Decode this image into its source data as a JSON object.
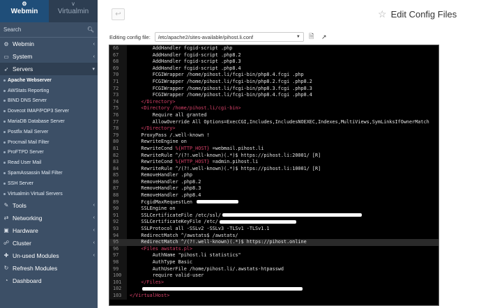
{
  "sidebar": {
    "tabs": [
      {
        "label": "Webmin",
        "icon": "webmin-logo-icon"
      },
      {
        "label": "Virtualmin",
        "icon": "virtualmin-chevron-icon"
      }
    ],
    "search_label": "Search",
    "items_top": [
      {
        "label": "Webmin",
        "icon": "gear-icon"
      },
      {
        "label": "System",
        "icon": "monitor-icon"
      },
      {
        "label": "Servers",
        "icon": "rocket-icon",
        "open": true
      }
    ],
    "server_modules": [
      "Apache Webserver",
      "AWStats Reporting",
      "BIND DNS Server",
      "Dovecot IMAP/POP3 Server",
      "MariaDB Database Server",
      "Postfix Mail Server",
      "Procmail Mail Filter",
      "ProFTPD Server",
      "Read User Mail",
      "SpamAssassin Mail Filter",
      "SSH Server",
      "Virtualmin Virtual Servers"
    ],
    "items_bottom": [
      {
        "label": "Tools",
        "icon": "wrench-icon",
        "chev": true
      },
      {
        "label": "Networking",
        "icon": "network-icon",
        "chev": true
      },
      {
        "label": "Hardware",
        "icon": "hardware-icon",
        "chev": true
      },
      {
        "label": "Cluster",
        "icon": "cluster-icon",
        "chev": true
      },
      {
        "label": "Un-used Modules",
        "icon": "puzzle-icon",
        "chev": true
      },
      {
        "label": "Refresh Modules",
        "icon": "refresh-icon",
        "chev": false
      },
      {
        "label": "Dashboard",
        "icon": "dashboard-icon",
        "chev": false
      }
    ]
  },
  "main": {
    "title": "Edit Config Files",
    "editing_label": "Editing config file:",
    "config_file": "/etc/apache2/sites-available/pihost.li.conf"
  },
  "editor": {
    "lines": [
      {
        "n": "66",
        "t": "        AddHandler fcgid-script .php"
      },
      {
        "n": "67",
        "t": "        AddHandler fcgid-script .php8.2"
      },
      {
        "n": "68",
        "t": "        AddHandler fcgid-script .php8.3"
      },
      {
        "n": "69",
        "t": "        AddHandler fcgid-script .php8.4"
      },
      {
        "n": "70",
        "t": "        FCGIWrapper /home/pihost.li/fcgi-bin/php8.4.fcgi .php"
      },
      {
        "n": "71",
        "t": "        FCGIWrapper /home/pihost.li/fcgi-bin/php8.2.fcgi .php8.2"
      },
      {
        "n": "72",
        "t": "        FCGIWrapper /home/pihost.li/fcgi-bin/php8.3.fcgi .php8.3"
      },
      {
        "n": "73",
        "t": "        FCGIWrapper /home/pihost.li/fcgi-bin/php8.4.fcgi .php8.4"
      },
      {
        "n": "74",
        "t": "    </Directory>",
        "tag": true
      },
      {
        "n": "75",
        "t": "    <Directory /home/pihost.li/cgi-bin>",
        "tag": true
      },
      {
        "n": "76",
        "t": "        Require all granted"
      },
      {
        "n": "77",
        "t": "        AllowOverride All Options=ExecCGI,Includes,IncludesNOEXEC,Indexes,MultiViews,SymLinksIfOwnerMatch"
      },
      {
        "n": "78",
        "t": "    </Directory>",
        "tag": true
      },
      {
        "n": "79",
        "t": "    ProxyPass /.well-known !"
      },
      {
        "n": "80",
        "t": "    RewriteEngine on"
      },
      {
        "n": "81",
        "a": "    RewriteCond ",
        "r": "%{HTTP_HOST}",
        "b": " =webmail.pihost.li"
      },
      {
        "n": "82",
        "t": "    RewriteRule ^/(?!.well-known)(.*)$ https://pihost.li:20001/ [R]"
      },
      {
        "n": "83",
        "a": "    RewriteCond ",
        "r": "%{HTTP_HOST}",
        "b": " =admin.pihost.li"
      },
      {
        "n": "84",
        "t": "    RewriteRule ^/(?!.well-known)(.*)$ https://pihost.li:10001/ [R]"
      },
      {
        "n": "85",
        "t": "    RemoveHandler .php"
      },
      {
        "n": "86",
        "t": "    RemoveHandler .php8.2"
      },
      {
        "n": "87",
        "t": "    RemoveHandler .php8.3"
      },
      {
        "n": "88",
        "t": "    RemoveHandler .php8.4"
      },
      {
        "n": "89",
        "t": "    FcgidMaxRequestLen ",
        "redact": 60
      },
      {
        "n": "90",
        "t": "    SSLEngine on"
      },
      {
        "n": "91",
        "t": "    SSLCertificateFile /etc/ssl/",
        "redact": 200
      },
      {
        "n": "92",
        "t": "    SSLCertificateKeyFile /etc/",
        "redact": 110
      },
      {
        "n": "93",
        "t": "    SSLProtocol all -SSLv2 -SSLv3 -TLSv1 -TLSv1.1"
      },
      {
        "n": "94",
        "t": "    RedirectMatch ^/awstats$ /awstats/"
      },
      {
        "n": "95",
        "t": "    RedirectMatch ^/(?!.well-known)(.*)$ https://pihost.online",
        "hl": true,
        "arrow": true
      },
      {
        "n": "96",
        "t": "    <Files awstats.pl>",
        "tag": true
      },
      {
        "n": "97",
        "t": "        AuthName \"pihost.li statistics\""
      },
      {
        "n": "98",
        "t": "        AuthType Basic"
      },
      {
        "n": "99",
        "t": "        AuthUserFile /home/pihost.li/.awstats-htpasswd"
      },
      {
        "n": "100",
        "t": "        require valid-user"
      },
      {
        "n": "101",
        "t": "    </Files>",
        "tag": true
      },
      {
        "n": "102",
        "t": "    ",
        "redact": 230
      },
      {
        "n": "103",
        "t": "</VirtualHost>",
        "tag": true
      }
    ]
  }
}
